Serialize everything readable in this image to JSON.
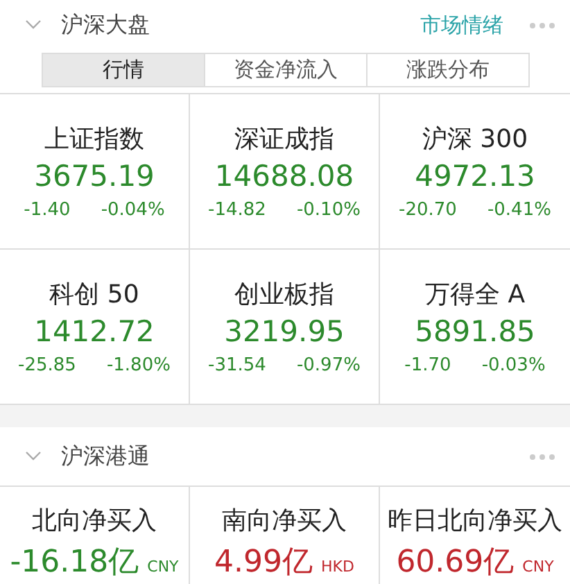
{
  "market": {
    "title": "沪深大盘",
    "expanded": true,
    "link": "市场情绪",
    "tabs": [
      {
        "label": "行情",
        "selected": true
      },
      {
        "label": "资金净流入",
        "selected": false
      },
      {
        "label": "涨跌分布",
        "selected": false
      }
    ],
    "indices": [
      {
        "name": "上证指数",
        "value": "3675.19",
        "change": "-1.40",
        "pct": "-0.04%",
        "color": "#2c8a2c"
      },
      {
        "name": "深证成指",
        "value": "14688.08",
        "change": "-14.82",
        "pct": "-0.10%",
        "color": "#2c8a2c"
      },
      {
        "name": "沪深 300",
        "value": "4972.13",
        "change": "-20.70",
        "pct": "-0.41%",
        "color": "#2c8a2c"
      },
      {
        "name": "科创 50",
        "value": "1412.72",
        "change": "-25.85",
        "pct": "-1.80%",
        "color": "#2c8a2c"
      },
      {
        "name": "创业板指",
        "value": "3219.95",
        "change": "-31.54",
        "pct": "-0.97%",
        "color": "#2c8a2c"
      },
      {
        "name": "万得全 A",
        "value": "5891.85",
        "change": "-1.70",
        "pct": "-0.03%",
        "color": "#2c8a2c"
      }
    ]
  },
  "connect": {
    "title": "沪深港通",
    "expanded": true,
    "flows": [
      {
        "name": "北向净买入",
        "value": "-16.18亿",
        "unit": "CNY",
        "color": "#2c8a2c"
      },
      {
        "name": "南向净买入",
        "value": "4.99亿",
        "unit": "HKD",
        "color": "#c0272d"
      },
      {
        "name": "昨日北向净买入",
        "value": "60.69亿",
        "unit": "CNY",
        "color": "#c0272d"
      }
    ]
  }
}
